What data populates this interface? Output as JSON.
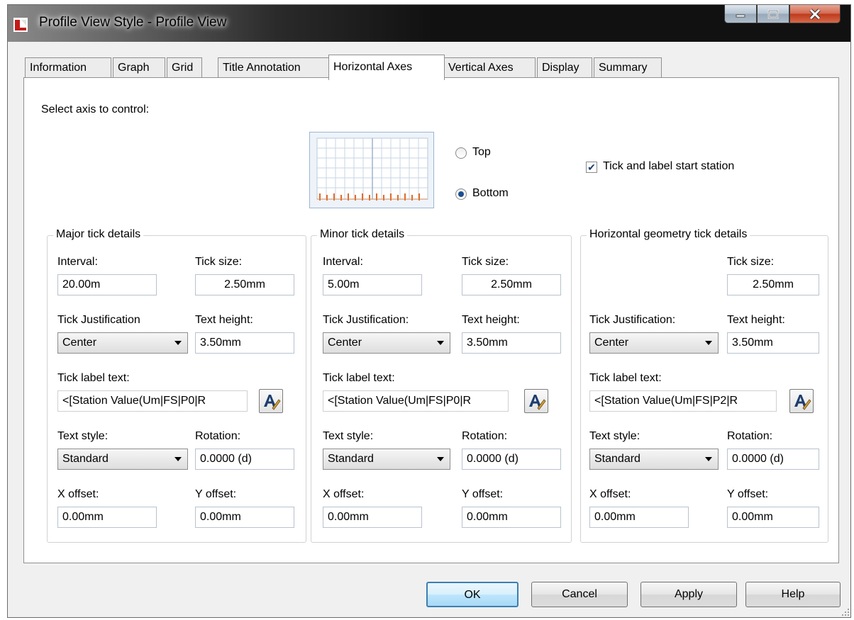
{
  "window": {
    "title": "Profile View Style - Profile View"
  },
  "tabs": [
    {
      "label": "Information"
    },
    {
      "label": "Graph"
    },
    {
      "label": "Grid"
    },
    {
      "label": "Title Annotation"
    },
    {
      "label": "Horizontal Axes",
      "active": true
    },
    {
      "label": "Vertical Axes"
    },
    {
      "label": "Display"
    },
    {
      "label": "Summary"
    }
  ],
  "axis": {
    "select_label": "Select axis to control:",
    "top_label": "Top",
    "bottom_label": "Bottom",
    "selected": "Bottom",
    "tick_start_label": "Tick and label start station",
    "tick_start_checked": true
  },
  "major": {
    "title": "Major tick details",
    "interval_label": "Interval:",
    "interval": "20.00m",
    "tick_size_label": "Tick size:",
    "tick_size": "2.50mm",
    "justification_label": "Tick Justification",
    "justification": "Center",
    "text_height_label": "Text height:",
    "text_height": "3.50mm",
    "label_text_label": "Tick label text:",
    "label_text": "<[Station Value(Um|FS|P0|R",
    "text_style_label": "Text style:",
    "text_style": "Standard",
    "rotation_label": "Rotation:",
    "rotation": "0.0000 (d)",
    "x_offset_label": "X offset:",
    "x_offset": "0.00mm",
    "y_offset_label": "Y offset:",
    "y_offset": "0.00mm"
  },
  "minor": {
    "title": "Minor tick details",
    "interval_label": "Interval:",
    "interval": "5.00m",
    "tick_size_label": "Tick size:",
    "tick_size": "2.50mm",
    "justification_label": "Tick Justification:",
    "justification": "Center",
    "text_height_label": "Text height:",
    "text_height": "3.50mm",
    "label_text_label": "Tick label text:",
    "label_text": "<[Station Value(Um|FS|P0|R",
    "text_style_label": "Text style:",
    "text_style": "Standard",
    "rotation_label": "Rotation:",
    "rotation": "0.0000 (d)",
    "x_offset_label": "X offset:",
    "x_offset": "0.00mm",
    "y_offset_label": "Y offset:",
    "y_offset": "0.00mm"
  },
  "geometry": {
    "title": "Horizontal geometry tick details",
    "tick_size_label": "Tick size:",
    "tick_size": "2.50mm",
    "justification_label": "Tick Justification:",
    "justification": "Center",
    "text_height_label": "Text height:",
    "text_height": "3.50mm",
    "label_text_label": "Tick label text:",
    "label_text": "<[Station Value(Um|FS|P2|R",
    "text_style_label": "Text style:",
    "text_style": "Standard",
    "rotation_label": "Rotation:",
    "rotation": "0.0000 (d)",
    "x_offset_label": "X offset:",
    "x_offset": "0.00mm",
    "y_offset_label": "Y offset:",
    "y_offset": "0.00mm"
  },
  "buttons": {
    "ok": "OK",
    "cancel": "Cancel",
    "apply": "Apply",
    "help": "Help"
  },
  "colors": {
    "tick_preview": "#e06a2c",
    "selection_blue": "#3c7fb1",
    "close_red": "#c0391b"
  },
  "icons": [
    "app-icon",
    "minimize-icon",
    "maximize-icon",
    "close-icon",
    "text-component-editor-icon",
    "axis-preview-icon"
  ]
}
